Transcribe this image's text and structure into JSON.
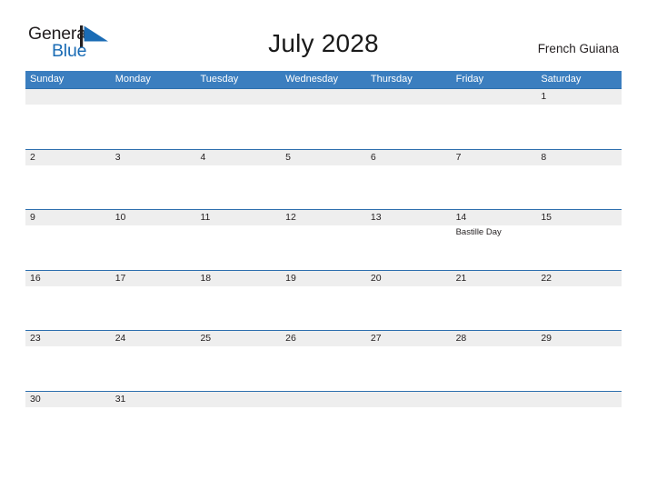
{
  "brand": {
    "name_part1": "General",
    "name_part2": "Blue",
    "flag_icon": "flag-triangle-icon",
    "flag_color": "#1b6cb5",
    "text_color": "#231f20"
  },
  "header": {
    "title": "July 2028",
    "locale": "French Guiana"
  },
  "theme": {
    "header_blue": "#3b7ebf",
    "row_rule_blue": "#2d6fae",
    "band_gray": "#eeeeee",
    "text_dark": "#231f20",
    "page_background": "#ffffff"
  },
  "calendar": {
    "weekdays": [
      "Sunday",
      "Monday",
      "Tuesday",
      "Wednesday",
      "Thursday",
      "Friday",
      "Saturday"
    ],
    "weeks": [
      {
        "days": [
          {
            "number": "",
            "event": ""
          },
          {
            "number": "",
            "event": ""
          },
          {
            "number": "",
            "event": ""
          },
          {
            "number": "",
            "event": ""
          },
          {
            "number": "",
            "event": ""
          },
          {
            "number": "",
            "event": ""
          },
          {
            "number": "1",
            "event": ""
          }
        ]
      },
      {
        "days": [
          {
            "number": "2",
            "event": ""
          },
          {
            "number": "3",
            "event": ""
          },
          {
            "number": "4",
            "event": ""
          },
          {
            "number": "5",
            "event": ""
          },
          {
            "number": "6",
            "event": ""
          },
          {
            "number": "7",
            "event": ""
          },
          {
            "number": "8",
            "event": ""
          }
        ]
      },
      {
        "days": [
          {
            "number": "9",
            "event": ""
          },
          {
            "number": "10",
            "event": ""
          },
          {
            "number": "11",
            "event": ""
          },
          {
            "number": "12",
            "event": ""
          },
          {
            "number": "13",
            "event": ""
          },
          {
            "number": "14",
            "event": "Bastille Day"
          },
          {
            "number": "15",
            "event": ""
          }
        ]
      },
      {
        "days": [
          {
            "number": "16",
            "event": ""
          },
          {
            "number": "17",
            "event": ""
          },
          {
            "number": "18",
            "event": ""
          },
          {
            "number": "19",
            "event": ""
          },
          {
            "number": "20",
            "event": ""
          },
          {
            "number": "21",
            "event": ""
          },
          {
            "number": "22",
            "event": ""
          }
        ]
      },
      {
        "days": [
          {
            "number": "23",
            "event": ""
          },
          {
            "number": "24",
            "event": ""
          },
          {
            "number": "25",
            "event": ""
          },
          {
            "number": "26",
            "event": ""
          },
          {
            "number": "27",
            "event": ""
          },
          {
            "number": "28",
            "event": ""
          },
          {
            "number": "29",
            "event": ""
          }
        ]
      },
      {
        "days": [
          {
            "number": "30",
            "event": ""
          },
          {
            "number": "31",
            "event": ""
          },
          {
            "number": "",
            "event": ""
          },
          {
            "number": "",
            "event": ""
          },
          {
            "number": "",
            "event": ""
          },
          {
            "number": "",
            "event": ""
          },
          {
            "number": "",
            "event": ""
          }
        ]
      }
    ]
  }
}
